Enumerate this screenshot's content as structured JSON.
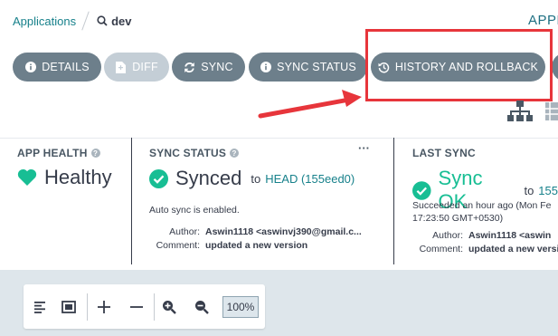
{
  "breadcrumb": {
    "root": "Applications",
    "current": "dev"
  },
  "header": {
    "right_text": "APPL"
  },
  "toolbar": {
    "details": "DETAILS",
    "diff": "DIFF",
    "sync": "SYNC",
    "sync_status": "SYNC STATUS",
    "history": "HISTORY AND ROLLBACK"
  },
  "app_health": {
    "label": "APP HEALTH",
    "value": "Healthy",
    "color": "#18be94"
  },
  "sync_status": {
    "label": "SYNC STATUS",
    "value": "Synced",
    "to_text": "to",
    "revision": "HEAD (155eed0)",
    "auto_sync": "Auto sync is enabled.",
    "author_key": "Author:",
    "author_val": "Aswin1118 <aswinvj390@gmail.c...",
    "comment_key": "Comment:",
    "comment_val": "updated a new version",
    "menu": "···"
  },
  "last_sync": {
    "label": "LAST SYNC",
    "value": "Sync OK",
    "to_text": "to",
    "revision": "155",
    "when_line1": "Succeeded an hour ago (Mon Fe",
    "when_line2": "17:23:50 GMT+0530)",
    "author_key": "Author:",
    "author_val": "Aswin1118 <aswin",
    "comment_key": "Comment:",
    "comment_val": "updated a new version"
  },
  "zoom": {
    "percent": "100%"
  },
  "colors": {
    "accent": "#17818b",
    "success": "#18be94",
    "highlight": "#e7353b",
    "button": "#6d7f8b"
  }
}
